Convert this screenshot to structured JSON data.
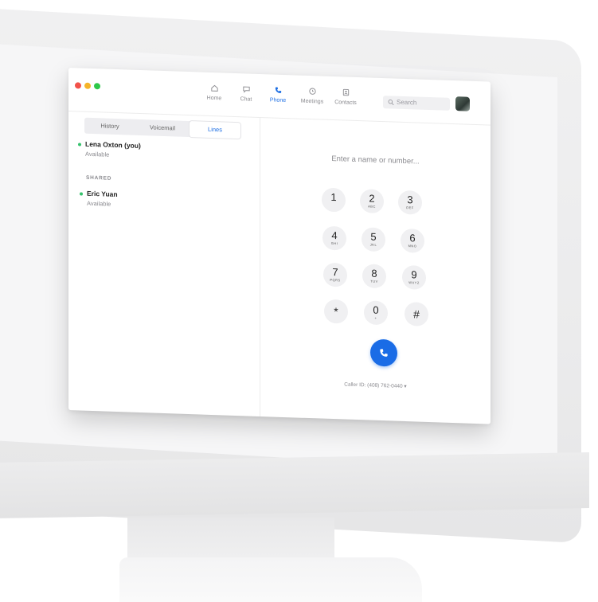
{
  "nav": {
    "tabs": [
      {
        "label": "Home",
        "icon": "home-icon"
      },
      {
        "label": "Chat",
        "icon": "chat-icon"
      },
      {
        "label": "Phone",
        "icon": "phone-icon",
        "active": true
      },
      {
        "label": "Meetings",
        "icon": "clock-icon"
      },
      {
        "label": "Contacts",
        "icon": "contacts-icon"
      }
    ],
    "search_placeholder": "Search"
  },
  "phone_tabs": [
    {
      "label": "History"
    },
    {
      "label": "Voicemail"
    },
    {
      "label": "Lines",
      "active": true
    }
  ],
  "lines": {
    "self": {
      "name": "Lena Oxton (you)",
      "status": "Available"
    },
    "shared_label": "SHARED",
    "shared": [
      {
        "name": "Eric Yuan",
        "status": "Available"
      }
    ]
  },
  "dialer": {
    "placeholder": "Enter a name or number...",
    "keys": [
      {
        "digit": "1",
        "letters": ""
      },
      {
        "digit": "2",
        "letters": "ABC"
      },
      {
        "digit": "3",
        "letters": "DEF"
      },
      {
        "digit": "4",
        "letters": "GHI"
      },
      {
        "digit": "5",
        "letters": "JKL"
      },
      {
        "digit": "6",
        "letters": "MNO"
      },
      {
        "digit": "7",
        "letters": "PQRS"
      },
      {
        "digit": "8",
        "letters": "TUV"
      },
      {
        "digit": "9",
        "letters": "WXYZ"
      },
      {
        "digit": "*",
        "letters": ""
      },
      {
        "digit": "0",
        "letters": "+"
      },
      {
        "digit": "#",
        "letters": ""
      }
    ],
    "caller_id": "Caller ID: (408) 762-0440 ▾"
  },
  "colors": {
    "accent": "#1e6fe3",
    "call_button": "#1a6ce6",
    "presence_available": "#35c26c",
    "traffic_red": "#f2524a",
    "traffic_yellow": "#f5b428",
    "traffic_green": "#2ec84a"
  }
}
